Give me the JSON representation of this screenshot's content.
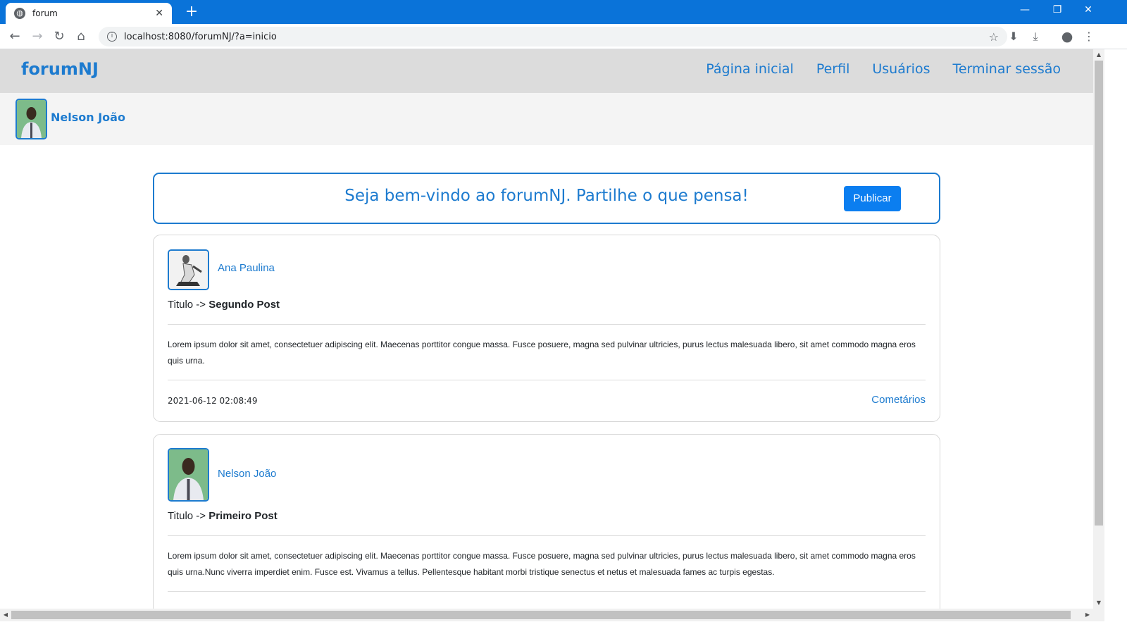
{
  "browser": {
    "tab_title": "forum",
    "url": "localhost:8080/forumNJ/?a=inicio"
  },
  "site": {
    "brand": "forumNJ",
    "nav": [
      "Página inicial",
      "Perfil",
      "Usuários",
      "Terminar sessão"
    ]
  },
  "current_user": {
    "name": "Nelson João"
  },
  "welcome": {
    "message": "Seja bem-vindo ao forumNJ. Partilhe o que pensa!",
    "publish_label": "Publicar"
  },
  "posts": [
    {
      "author": "Ana Paulina",
      "title_prefix": "Titulo ->",
      "title": "Segundo Post",
      "body": "Lorem ipsum dolor sit amet, consectetuer adipiscing elit. Maecenas porttitor congue massa. Fusce posuere, magna sed pulvinar ultricies, purus lectus malesuada libero, sit amet commodo magna eros quis urna.",
      "date": "2021-06-12 02:08:49",
      "comments_label": "Cometários"
    },
    {
      "author": "Nelson João",
      "title_prefix": "Titulo ->",
      "title": "Primeiro Post",
      "body": "Lorem ipsum dolor sit amet, consectetuer adipiscing elit. Maecenas porttitor congue massa. Fusce posuere, magna sed pulvinar ultricies, purus lectus malesuada libero, sit amet commodo magna eros quis urna.Nunc viverra imperdiet enim. Fusce est. Vivamus a tellus. Pellentesque habitant morbi tristique senectus et netus et malesuada fames ac turpis egestas."
    }
  ],
  "colors": {
    "accent": "#1d7bcf",
    "button": "#0b7ef0",
    "chrome": "#0a73d9"
  }
}
